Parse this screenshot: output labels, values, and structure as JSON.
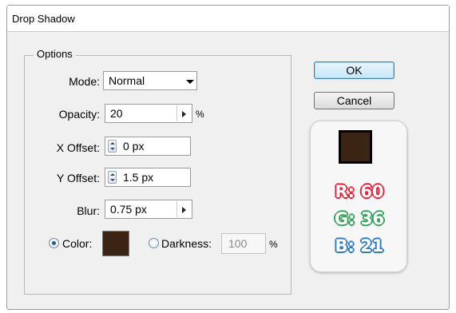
{
  "dialog": {
    "title": "Drop Shadow"
  },
  "options": {
    "legend": "Options",
    "mode": {
      "label": "Mode:",
      "value": "Normal"
    },
    "opacity": {
      "label": "Opacity:",
      "value": "20",
      "unit": "%"
    },
    "x_offset": {
      "label": "X Offset:",
      "value": "0 px"
    },
    "y_offset": {
      "label": "Y Offset:",
      "value": "1.5 px"
    },
    "blur": {
      "label": "Blur:",
      "value": "0.75 px"
    },
    "color": {
      "label": "Color:",
      "selected": true,
      "swatch": "#3c2415"
    },
    "darkness": {
      "label": "Darkness:",
      "value": "100",
      "unit": "%",
      "selected": false
    }
  },
  "buttons": {
    "ok": "OK",
    "cancel": "Cancel"
  },
  "color_info": {
    "swatch": "#3c2415",
    "r": "R: 60",
    "g": "G: 36",
    "b": "B: 21",
    "r_color": "#e8233a",
    "g_color": "#35a35a",
    "b_color": "#2f7cc4"
  }
}
